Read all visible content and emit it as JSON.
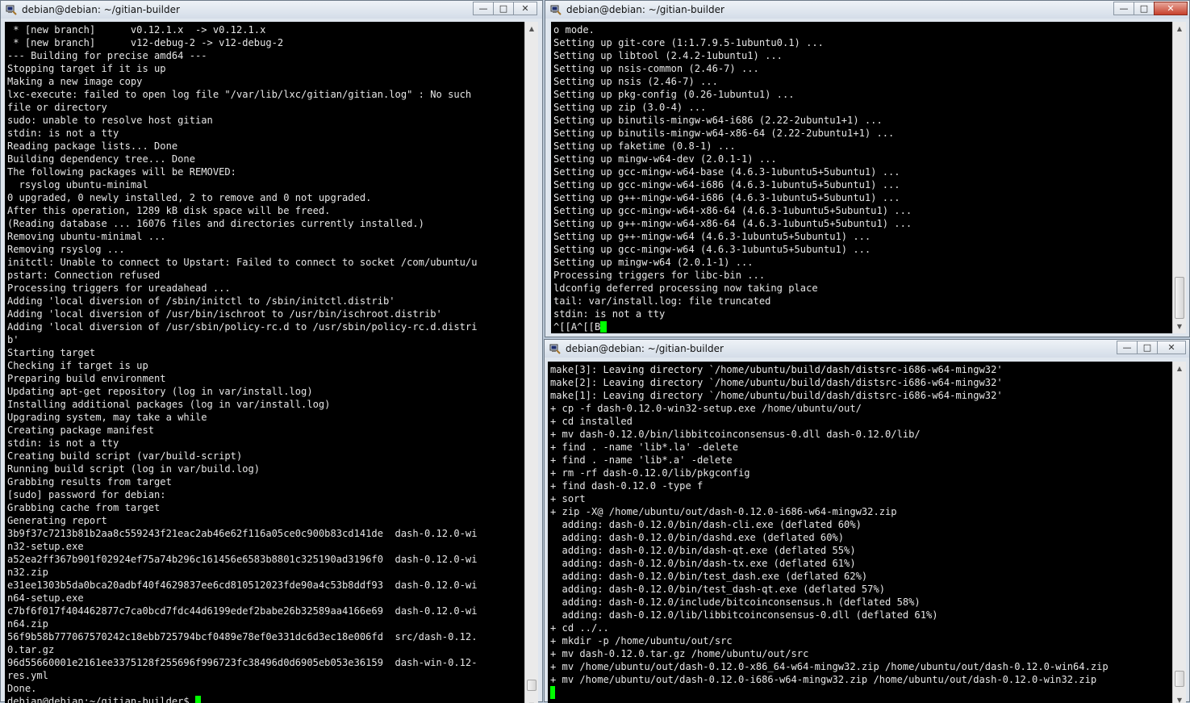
{
  "windows": {
    "left": {
      "title": "debian@debian: ~/gitian-builder",
      "lines": [
        " * [new branch]      v0.12.1.x  -> v0.12.1.x",
        " * [new branch]      v12-debug-2 -> v12-debug-2",
        "--- Building for precise amd64 ---",
        "Stopping target if it is up",
        "Making a new image copy",
        "lxc-execute: failed to open log file \"/var/lib/lxc/gitian/gitian.log\" : No such",
        "file or directory",
        "sudo: unable to resolve host gitian",
        "stdin: is not a tty",
        "Reading package lists... Done",
        "Building dependency tree... Done",
        "The following packages will be REMOVED:",
        "  rsyslog ubuntu-minimal",
        "0 upgraded, 0 newly installed, 2 to remove and 0 not upgraded.",
        "After this operation, 1289 kB disk space will be freed.",
        "(Reading database ... 16076 files and directories currently installed.)",
        "Removing ubuntu-minimal ...",
        "Removing rsyslog ...",
        "initctl: Unable to connect to Upstart: Failed to connect to socket /com/ubuntu/u",
        "pstart: Connection refused",
        "Processing triggers for ureadahead ...",
        "Adding 'local diversion of /sbin/initctl to /sbin/initctl.distrib'",
        "Adding 'local diversion of /usr/bin/ischroot to /usr/bin/ischroot.distrib'",
        "Adding 'local diversion of /usr/sbin/policy-rc.d to /usr/sbin/policy-rc.d.distri",
        "b'",
        "Starting target",
        "Checking if target is up",
        "Preparing build environment",
        "Updating apt-get repository (log in var/install.log)",
        "Installing additional packages (log in var/install.log)",
        "Upgrading system, may take a while",
        "Creating package manifest",
        "stdin: is not a tty",
        "Creating build script (var/build-script)",
        "Running build script (log in var/build.log)",
        "Grabbing results from target",
        "[sudo] password for debian:",
        "Grabbing cache from target",
        "Generating report",
        "3b9f37c7213b81b2aa8c559243f21eac2ab46e62f116a05ce0c900b83cd141de  dash-0.12.0-wi",
        "n32-setup.exe",
        "a52ea2ff367b901f02924ef75a74b296c161456e6583b8801c325190ad3196f0  dash-0.12.0-wi",
        "n32.zip",
        "e31ee1303b5da0bca20adbf40f4629837ee6cd810512023fde90a4c53b8ddf93  dash-0.12.0-wi",
        "n64-setup.exe",
        "c7bf6f017f404462877c7ca0bcd7fdc44d6199edef2babe26b32589aa4166e69  dash-0.12.0-wi",
        "n64.zip",
        "56f9b58b777067570242c18ebb725794bcf0489e78ef0e331dc6d3ec18e006fd  src/dash-0.12.",
        "0.tar.gz",
        "96d55660001e2161ee3375128f255696f996723fc38496d0d6905eb053e36159  dash-win-0.12-",
        "res.yml",
        "Done."
      ],
      "prompt": "debian@debian:~/gitian-builder$ "
    },
    "top_right": {
      "title": "debian@debian: ~/gitian-builder",
      "lines": [
        "o mode.",
        "Setting up git-core (1:1.7.9.5-1ubuntu0.1) ...",
        "Setting up libtool (2.4.2-1ubuntu1) ...",
        "Setting up nsis-common (2.46-7) ...",
        "Setting up nsis (2.46-7) ...",
        "Setting up pkg-config (0.26-1ubuntu1) ...",
        "Setting up zip (3.0-4) ...",
        "Setting up binutils-mingw-w64-i686 (2.22-2ubuntu1+1) ...",
        "Setting up binutils-mingw-w64-x86-64 (2.22-2ubuntu1+1) ...",
        "Setting up faketime (0.8-1) ...",
        "Setting up mingw-w64-dev (2.0.1-1) ...",
        "Setting up gcc-mingw-w64-base (4.6.3-1ubuntu5+5ubuntu1) ...",
        "Setting up gcc-mingw-w64-i686 (4.6.3-1ubuntu5+5ubuntu1) ...",
        "Setting up g++-mingw-w64-i686 (4.6.3-1ubuntu5+5ubuntu1) ...",
        "Setting up gcc-mingw-w64-x86-64 (4.6.3-1ubuntu5+5ubuntu1) ...",
        "Setting up g++-mingw-w64-x86-64 (4.6.3-1ubuntu5+5ubuntu1) ...",
        "Setting up g++-mingw-w64 (4.6.3-1ubuntu5+5ubuntu1) ...",
        "Setting up gcc-mingw-w64 (4.6.3-1ubuntu5+5ubuntu1) ...",
        "Setting up mingw-w64 (2.0.1-1) ...",
        "Processing triggers for libc-bin ...",
        "ldconfig deferred processing now taking place",
        "tail: var/install.log: file truncated",
        "stdin: is not a tty"
      ],
      "prompt": "^[[A^[[B"
    },
    "bottom_right": {
      "title": "debian@debian: ~/gitian-builder",
      "lines": [
        "make[3]: Leaving directory `/home/ubuntu/build/dash/distsrc-i686-w64-mingw32'",
        "make[2]: Leaving directory `/home/ubuntu/build/dash/distsrc-i686-w64-mingw32'",
        "make[1]: Leaving directory `/home/ubuntu/build/dash/distsrc-i686-w64-mingw32'",
        "+ cp -f dash-0.12.0-win32-setup.exe /home/ubuntu/out/",
        "+ cd installed",
        "+ mv dash-0.12.0/bin/libbitcoinconsensus-0.dll dash-0.12.0/lib/",
        "+ find . -name 'lib*.la' -delete",
        "+ find . -name 'lib*.a' -delete",
        "+ rm -rf dash-0.12.0/lib/pkgconfig",
        "+ find dash-0.12.0 -type f",
        "+ sort",
        "+ zip -X@ /home/ubuntu/out/dash-0.12.0-i686-w64-mingw32.zip",
        "  adding: dash-0.12.0/bin/dash-cli.exe (deflated 60%)",
        "  adding: dash-0.12.0/bin/dashd.exe (deflated 60%)",
        "  adding: dash-0.12.0/bin/dash-qt.exe (deflated 55%)",
        "  adding: dash-0.12.0/bin/dash-tx.exe (deflated 61%)",
        "  adding: dash-0.12.0/bin/test_dash.exe (deflated 62%)",
        "  adding: dash-0.12.0/bin/test_dash-qt.exe (deflated 57%)",
        "  adding: dash-0.12.0/include/bitcoinconsensus.h (deflated 58%)",
        "  adding: dash-0.12.0/lib/libbitcoinconsensus-0.dll (deflated 61%)",
        "+ cd ../..",
        "+ mkdir -p /home/ubuntu/out/src",
        "+ mv dash-0.12.0.tar.gz /home/ubuntu/out/src",
        "+ mv /home/ubuntu/out/dash-0.12.0-x86_64-w64-mingw32.zip /home/ubuntu/out/dash-0.12.0-win64.zip",
        "+ mv /home/ubuntu/out/dash-0.12.0-i686-w64-mingw32.zip /home/ubuntu/out/dash-0.12.0-win32.zip"
      ],
      "prompt": ""
    }
  },
  "colors": {
    "terminal_bg": "#000000",
    "terminal_fg": "#e6e6e6",
    "cursor": "#00ff00",
    "close_active": "#c7412c"
  }
}
